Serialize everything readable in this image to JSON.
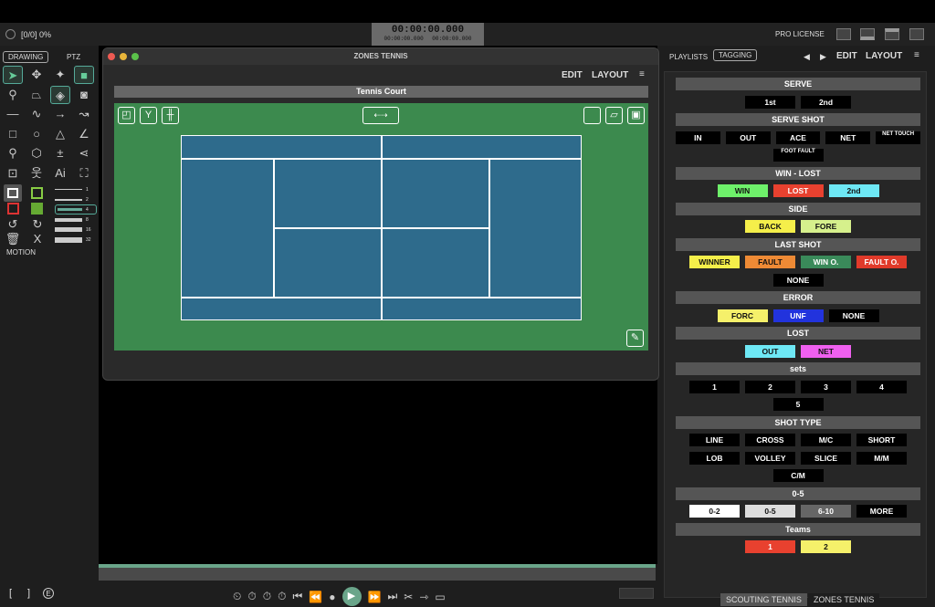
{
  "status": {
    "progress_text": "[0/0] 0%"
  },
  "timecode": {
    "main": "00:00:00.000",
    "sub1": "00:00:00.000",
    "sub2": "00:00:00.000"
  },
  "license": "PRO LICENSE",
  "left_panel": {
    "tabs": [
      "DRAWING",
      "PTZ"
    ],
    "line_widths": [
      "1",
      "2",
      "4",
      "8",
      "16",
      "32"
    ],
    "motion_label": "MOTION",
    "selected_width": "4"
  },
  "window": {
    "title": "ZONES TENNIS",
    "menu": [
      "EDIT",
      "LAYOUT"
    ],
    "court_title": "Tennis Court"
  },
  "right_panel": {
    "tabs": [
      "PLAYLISTS",
      "TAGGING"
    ],
    "active_tab": "TAGGING",
    "menu": [
      "EDIT",
      "LAYOUT"
    ],
    "sections": [
      {
        "title": "SERVE",
        "rows": [
          [
            {
              "label": "1st",
              "color": "#000000"
            },
            {
              "label": "2nd",
              "color": "#000000"
            }
          ]
        ]
      },
      {
        "title": "SERVE SHOT",
        "rows": [
          [
            {
              "label": "IN",
              "color": "#000000"
            },
            {
              "label": "OUT",
              "color": "#000000"
            },
            {
              "label": "ACE",
              "color": "#000000"
            },
            {
              "label": "NET",
              "color": "#000000"
            },
            {
              "label": "NET TOUCH",
              "color": "#000000"
            }
          ],
          [
            {
              "label": "FOOT FAULT",
              "color": "#000000"
            }
          ]
        ]
      },
      {
        "title": "WIN - LOST",
        "rows": [
          [
            {
              "label": "WIN",
              "color": "#6ef06a"
            },
            {
              "label": "LOST",
              "color": "#e8412f"
            },
            {
              "label": "2nd",
              "color": "#6ee8f5"
            }
          ]
        ]
      },
      {
        "title": "SIDE",
        "rows": [
          [
            {
              "label": "BACK",
              "color": "#f5ef4a"
            },
            {
              "label": "FORE",
              "color": "#d6f08c"
            }
          ]
        ]
      },
      {
        "title": "LAST SHOT",
        "rows": [
          [
            {
              "label": "WINNER",
              "color": "#f5ef4a"
            },
            {
              "label": "FAULT",
              "color": "#ee8a35"
            },
            {
              "label": "WIN O.",
              "color": "#3a8a5a"
            },
            {
              "label": "FAULT O.",
              "color": "#e03a2a"
            }
          ],
          [
            {
              "label": "NONE",
              "color": "#000000"
            }
          ]
        ]
      },
      {
        "title": "ERROR",
        "rows": [
          [
            {
              "label": "FORC",
              "color": "#f5f06a"
            },
            {
              "label": "UNF",
              "color": "#2233dd"
            },
            {
              "label": "NONE",
              "color": "#000000"
            }
          ]
        ]
      },
      {
        "title": "LOST",
        "rows": [
          [
            {
              "label": "OUT",
              "color": "#6ee8f5"
            },
            {
              "label": "NET",
              "color": "#f060f0"
            }
          ]
        ]
      },
      {
        "title": "sets",
        "rows": [
          [
            {
              "label": "1",
              "color": "#000000"
            },
            {
              "label": "2",
              "color": "#000000"
            },
            {
              "label": "3",
              "color": "#000000"
            },
            {
              "label": "4",
              "color": "#000000"
            }
          ],
          [
            {
              "label": "5",
              "color": "#000000"
            }
          ]
        ]
      },
      {
        "title": "SHOT TYPE",
        "rows": [
          [
            {
              "label": "LINE",
              "color": "#000000"
            },
            {
              "label": "CROSS",
              "color": "#000000"
            },
            {
              "label": "M/C",
              "color": "#000000"
            },
            {
              "label": "SHORT",
              "color": "#000000"
            }
          ],
          [
            {
              "label": "LOB",
              "color": "#000000"
            },
            {
              "label": "VOLLEY",
              "color": "#000000"
            },
            {
              "label": "SLICE",
              "color": "#000000"
            },
            {
              "label": "M/M",
              "color": "#000000"
            }
          ],
          [
            {
              "label": "C/M",
              "color": "#000000"
            }
          ]
        ]
      },
      {
        "title": "0-5",
        "rows": [
          [
            {
              "label": "0-2",
              "color": "#ffffff"
            },
            {
              "label": "0-5",
              "color": "#dddddd"
            },
            {
              "label": "6-10",
              "color": "#666666"
            },
            {
              "label": "MORE",
              "color": "#000000"
            }
          ]
        ]
      },
      {
        "title": "Teams",
        "rows": [
          [
            {
              "label": "1",
              "color": "#e8412f"
            },
            {
              "label": "2",
              "color": "#f5f06a"
            }
          ]
        ]
      }
    ],
    "bottom_tabs": [
      "SCOUTING TENNIS",
      "ZONES TENNIS"
    ],
    "active_bottom_tab": "SCOUTING TENNIS"
  }
}
